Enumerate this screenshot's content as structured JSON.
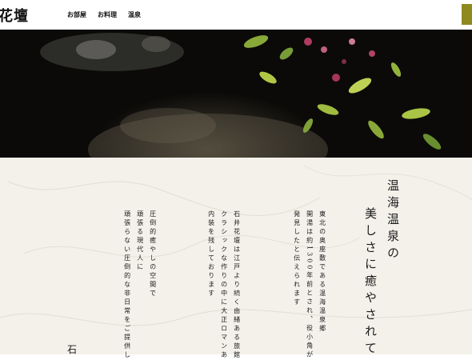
{
  "header": {
    "logo": "花壇",
    "nav": [
      {
        "label": "お部屋"
      },
      {
        "label": "お料理"
      },
      {
        "label": "温泉"
      }
    ]
  },
  "content": {
    "heading_lines": [
      "温海温泉の",
      "美しさに癒やされて"
    ],
    "intro": [
      "東北の奥座敷である温海温泉郷",
      "開湯は約1300年前とされ、役小角が",
      "発見したと伝えられます"
    ],
    "ryokan": [
      "石井花壇は江戸より続く由緒ある旅館",
      "クラシックな作りの中に大正ロマンあ",
      "内装を残しております"
    ],
    "appeal": [
      "圧倒的癒やしの空間で",
      "頑張る現代人に",
      "頑張らない圧倒的な非日常をご提供し"
    ],
    "footer_char": "石"
  },
  "colors": {
    "accent": "#8f8a1f",
    "paper": "#f3f1ea"
  }
}
